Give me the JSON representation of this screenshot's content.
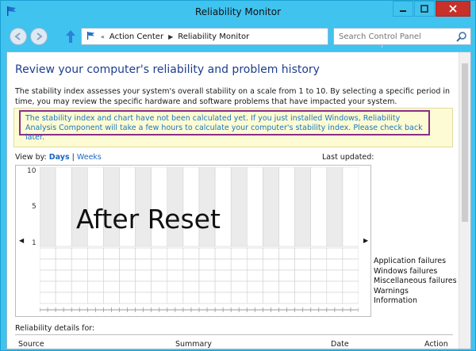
{
  "window": {
    "title": "Reliability Monitor",
    "accent": "#40c3ee",
    "close_color": "#c7312a"
  },
  "nav": {
    "back_icon": "back-arrow-icon",
    "forward_icon": "forward-arrow-icon",
    "up_icon": "up-arrow-icon",
    "breadcrumb": [
      "Action Center",
      "Reliability Monitor"
    ],
    "search_placeholder": "Search Control Panel"
  },
  "main": {
    "heading": "Review your computer's reliability and problem history",
    "description": "The stability index assesses your system's overall stability on a scale from 1 to 10. By selecting a specific period in time, you may review the specific hardware and software problems that have impacted your system.",
    "notice": "The stability index and chart have not been calculated yet. If you just installed Windows, Reliability Analysis Component will take a few hours to calculate your computer's stability index. Please check back later.",
    "view_by_label": "View by:",
    "view_days": "Days",
    "view_sep": "|",
    "view_weeks": "Weeks",
    "last_updated": "Last updated:",
    "overlay_text": "After Reset",
    "y_ticks": [
      "10",
      "5",
      "1"
    ],
    "legend": [
      "Application failures",
      "Windows failures",
      "Miscellaneous failures",
      "Warnings",
      "Information"
    ],
    "details_label": "Reliability details for:",
    "columns": [
      "Source",
      "Summary",
      "Date",
      "Action"
    ]
  }
}
